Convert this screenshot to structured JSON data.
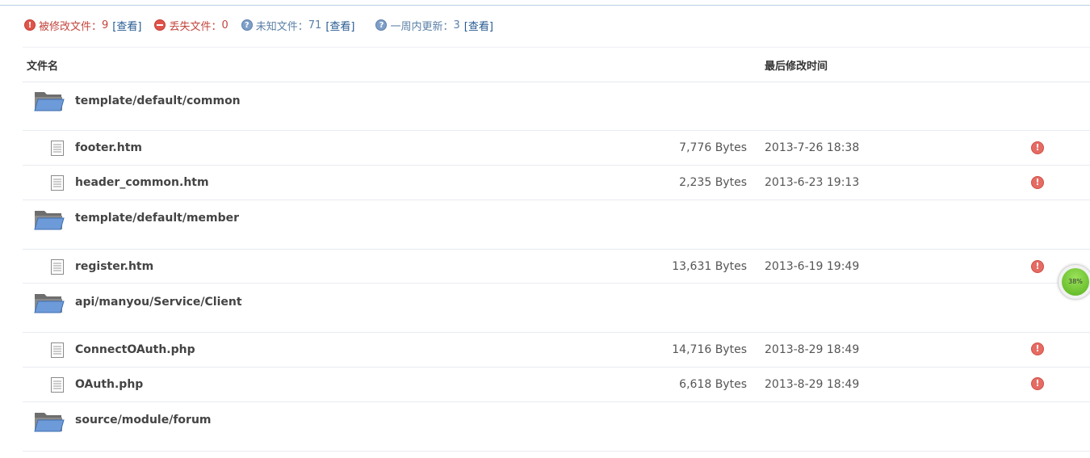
{
  "status": {
    "modified": {
      "label": "被修改文件：",
      "count": "9",
      "link": "[查看]"
    },
    "lost": {
      "label": "丢失文件：",
      "count": "0"
    },
    "unknown": {
      "label": "未知文件：",
      "count": "71",
      "link": "[查看]"
    },
    "recent": {
      "label": "一周内更新：",
      "count": "3",
      "link": "[查看]"
    }
  },
  "headers": {
    "name": "文件名",
    "time": "最后修改时间"
  },
  "rows": [
    {
      "type": "folder",
      "name": "template/default/common"
    },
    {
      "type": "file",
      "name": "footer.htm",
      "size": "7,776 Bytes",
      "time": "2013-7-26 18:38"
    },
    {
      "type": "file",
      "name": "header_common.htm",
      "size": "2,235 Bytes",
      "time": "2013-6-23 19:13"
    },
    {
      "type": "folder",
      "name": "template/default/member"
    },
    {
      "type": "file",
      "name": "register.htm",
      "size": "13,631 Bytes",
      "time": "2013-6-19 19:49"
    },
    {
      "type": "folder",
      "name": "api/manyou/Service/Client"
    },
    {
      "type": "file",
      "name": "ConnectOAuth.php",
      "size": "14,716 Bytes",
      "time": "2013-8-29 18:49"
    },
    {
      "type": "file",
      "name": "OAuth.php",
      "size": "6,618 Bytes",
      "time": "2013-8-29 18:49"
    },
    {
      "type": "folder",
      "name": "source/module/forum"
    }
  ],
  "progress": {
    "label": "38%",
    "value": 0.38
  },
  "icons": {
    "status_modified": "alert-icon",
    "status_lost": "minus-icon",
    "status_unknown": "question-icon",
    "status_recent": "question-icon",
    "folder": "folder-icon",
    "file": "file-icon",
    "row_alert": "alert-icon"
  },
  "colors": {
    "alert_red": "#e0544a",
    "info_blue": "#7e9fc8",
    "link_blue": "#275a91",
    "progress_green": "#58b21c"
  }
}
